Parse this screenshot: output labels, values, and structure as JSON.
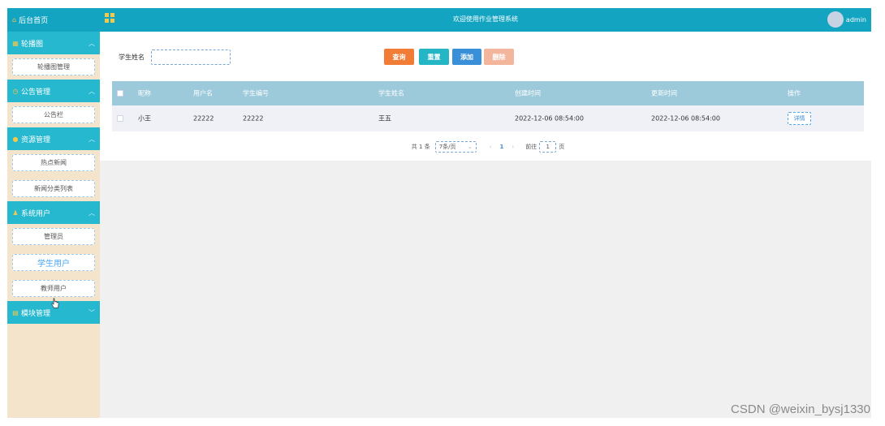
{
  "header": {
    "title": "欢迎使用作业管理系统",
    "user": "admin"
  },
  "sidebar": {
    "home": "后台首页",
    "groups": [
      {
        "label": "轮播图",
        "items": [
          "轮播图管理"
        ]
      },
      {
        "label": "公告管理",
        "items": [
          "公告栏"
        ]
      },
      {
        "label": "资源管理",
        "items": [
          "热点新闻",
          "新闻分类列表"
        ]
      },
      {
        "label": "系统用户",
        "items": [
          "管理员",
          "学生用户",
          "教师用户"
        ]
      },
      {
        "label": "模块管理",
        "items": []
      }
    ]
  },
  "search": {
    "label": "学生姓名",
    "value": "",
    "placeholder": ""
  },
  "buttons": {
    "query": "查询",
    "reset": "重置",
    "add": "添加",
    "delete": "删除"
  },
  "table": {
    "headers": [
      "昵称",
      "用户名",
      "学生编号",
      "学生姓名",
      "创建时间",
      "更新时间",
      "操作"
    ],
    "rows": [
      {
        "nickname": "小王",
        "username": "22222",
        "student_no": "22222",
        "student_name": "王五",
        "created": "2022-12-06 08:54:00",
        "updated": "2022-12-06 08:54:00",
        "action": "详情"
      }
    ]
  },
  "pagination": {
    "total": "共 1 条",
    "page_size": "7条/页",
    "current_page": "1",
    "goto_label": "前往",
    "goto_value": "1",
    "page_unit": "页"
  },
  "watermark": "CSDN @weixin_bysj1330",
  "colors": {
    "topbar": "#12a4c0",
    "sidebar_group": "#26b8cf",
    "sidebar_bg": "#f5e4cc",
    "table_header": "#9ccadb",
    "query": "#f07c36",
    "reset": "#25b6c6",
    "add": "#3a8fd9",
    "delete": "#f4b59d"
  }
}
